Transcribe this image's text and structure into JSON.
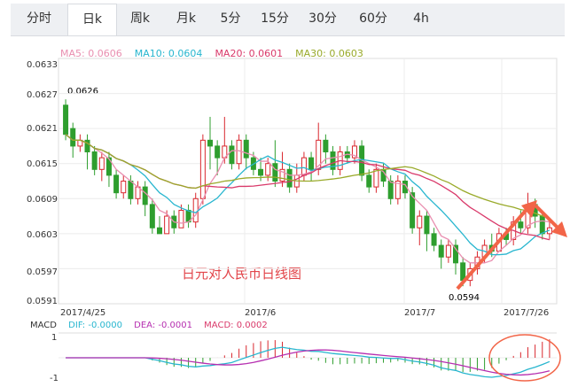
{
  "tabs": [
    {
      "label": "分时",
      "active": false
    },
    {
      "label": "日k",
      "active": true
    },
    {
      "label": "周k",
      "active": false
    },
    {
      "label": "月k",
      "active": false
    },
    {
      "label": "5分",
      "active": false
    },
    {
      "label": "15分",
      "active": false
    },
    {
      "label": "30分",
      "active": false
    },
    {
      "label": "60分",
      "active": false
    },
    {
      "label": "4h",
      "active": false
    }
  ],
  "ma_legend": [
    {
      "text": "MA5: 0.0606",
      "color": "#e98fb0"
    },
    {
      "text": "MA10: 0.0604",
      "color": "#28b6cf"
    },
    {
      "text": "MA20: 0.0601",
      "color": "#d9396a"
    },
    {
      "text": "MA30: 0.0603",
      "color": "#99aa2a"
    }
  ],
  "y_ticks": [
    "0.0633",
    "0.0627",
    "0.0621",
    "0.0615",
    "0.0609",
    "0.0603",
    "0.0597",
    "0.0591"
  ],
  "x_ticks": [
    "2017/4/25",
    "2017/6",
    "2017/7",
    "2017/7/26"
  ],
  "annotations": {
    "high": "0.0626",
    "low": "0.0594"
  },
  "chart_title": "日元对人民币日线图",
  "macd": {
    "label": "MACD",
    "dif": "DIF: -0.0000",
    "dea": "DEA: -0.0001",
    "macd": "MACD: 0.0002",
    "dif_color": "#28b6cf",
    "dea_color": "#b62fb0",
    "macd_color": "#d9396a",
    "y_ticks": [
      "1",
      "-1"
    ]
  },
  "colors": {
    "up": "#d9272e",
    "down": "#2e9e2e",
    "arrow": "#f26548"
  },
  "chart_data": {
    "type": "candlestick",
    "ylim": [
      0.0591,
      0.0633
    ],
    "candles": [
      [
        0.0625,
        0.062,
        0.0626,
        0.0619
      ],
      [
        0.0621,
        0.0618,
        0.0622,
        0.0616
      ],
      [
        0.0618,
        0.0619,
        0.062,
        0.0617
      ],
      [
        0.0619,
        0.0617,
        0.062,
        0.0614
      ],
      [
        0.0617,
        0.0614,
        0.0618,
        0.0613
      ],
      [
        0.0614,
        0.0616,
        0.0617,
        0.0612
      ],
      [
        0.0616,
        0.0613,
        0.0617,
        0.0611
      ],
      [
        0.0613,
        0.061,
        0.0614,
        0.0609
      ],
      [
        0.061,
        0.0612,
        0.0613,
        0.0609
      ],
      [
        0.0612,
        0.0609,
        0.0613,
        0.0608
      ],
      [
        0.0609,
        0.0611,
        0.0612,
        0.0608
      ],
      [
        0.0611,
        0.0608,
        0.0612,
        0.0606
      ],
      [
        0.0608,
        0.0604,
        0.0609,
        0.0603
      ],
      [
        0.0604,
        0.0603,
        0.0606,
        0.0603
      ],
      [
        0.0603,
        0.0606,
        0.0607,
        0.0603
      ],
      [
        0.0606,
        0.0604,
        0.0607,
        0.0603
      ],
      [
        0.0604,
        0.0607,
        0.0608,
        0.0604
      ],
      [
        0.0607,
        0.0605,
        0.0608,
        0.0604
      ],
      [
        0.0605,
        0.0609,
        0.061,
        0.0604
      ],
      [
        0.0609,
        0.0619,
        0.062,
        0.0608
      ],
      [
        0.0619,
        0.0618,
        0.0623,
        0.0614
      ],
      [
        0.0618,
        0.0616,
        0.0619,
        0.0613
      ],
      [
        0.0616,
        0.0618,
        0.0623,
        0.0615
      ],
      [
        0.0618,
        0.0615,
        0.0619,
        0.0614
      ],
      [
        0.0615,
        0.0619,
        0.062,
        0.0614
      ],
      [
        0.0619,
        0.0616,
        0.062,
        0.0614
      ],
      [
        0.0616,
        0.0614,
        0.0617,
        0.0613
      ],
      [
        0.0614,
        0.0613,
        0.0616,
        0.0612
      ],
      [
        0.0613,
        0.0615,
        0.0616,
        0.0612
      ],
      [
        0.0615,
        0.0612,
        0.0619,
        0.0611
      ],
      [
        0.0612,
        0.0614,
        0.0617,
        0.0611
      ],
      [
        0.0614,
        0.0611,
        0.0615,
        0.061
      ],
      [
        0.0611,
        0.0613,
        0.0615,
        0.061
      ],
      [
        0.0613,
        0.0616,
        0.0617,
        0.0612
      ],
      [
        0.0616,
        0.0614,
        0.0617,
        0.0612
      ],
      [
        0.0614,
        0.0619,
        0.0622,
        0.0613
      ],
      [
        0.0619,
        0.0617,
        0.062,
        0.0615
      ],
      [
        0.0617,
        0.0614,
        0.0618,
        0.0613
      ],
      [
        0.0614,
        0.0617,
        0.0618,
        0.0613
      ],
      [
        0.0617,
        0.0616,
        0.0618,
        0.0615
      ],
      [
        0.0616,
        0.0618,
        0.0619,
        0.0615
      ],
      [
        0.0618,
        0.0613,
        0.0619,
        0.0612
      ],
      [
        0.0613,
        0.0611,
        0.0614,
        0.061
      ],
      [
        0.0611,
        0.0614,
        0.0615,
        0.061
      ],
      [
        0.0614,
        0.0612,
        0.0615,
        0.0611
      ],
      [
        0.0612,
        0.0609,
        0.0613,
        0.0608
      ],
      [
        0.0609,
        0.0612,
        0.0613,
        0.0608
      ],
      [
        0.0612,
        0.061,
        0.0613,
        0.0609
      ],
      [
        0.061,
        0.0604,
        0.0611,
        0.0603
      ],
      [
        0.0604,
        0.0606,
        0.0607,
        0.0601
      ],
      [
        0.0606,
        0.0603,
        0.0607,
        0.06
      ],
      [
        0.0603,
        0.0601,
        0.0604,
        0.06
      ],
      [
        0.0601,
        0.0599,
        0.0602,
        0.0597
      ],
      [
        0.0599,
        0.0601,
        0.0602,
        0.0598
      ],
      [
        0.0601,
        0.0598,
        0.0602,
        0.0596
      ],
      [
        0.0598,
        0.0595,
        0.0599,
        0.0594
      ],
      [
        0.0595,
        0.0597,
        0.0598,
        0.0594
      ],
      [
        0.0597,
        0.0599,
        0.06,
        0.0596
      ],
      [
        0.0599,
        0.0601,
        0.0602,
        0.0598
      ],
      [
        0.0601,
        0.06,
        0.0603,
        0.0599
      ],
      [
        0.06,
        0.0603,
        0.0604,
        0.06
      ],
      [
        0.0603,
        0.0602,
        0.0604,
        0.0601
      ],
      [
        0.0602,
        0.0605,
        0.0606,
        0.0601
      ],
      [
        0.0605,
        0.0604,
        0.0607,
        0.0603
      ],
      [
        0.0604,
        0.0608,
        0.061,
        0.0603
      ],
      [
        0.0608,
        0.0606,
        0.0609,
        0.0604
      ],
      [
        0.0606,
        0.0603,
        0.0607,
        0.0602
      ],
      [
        0.0603,
        0.0604,
        0.0605,
        0.0602
      ]
    ]
  }
}
